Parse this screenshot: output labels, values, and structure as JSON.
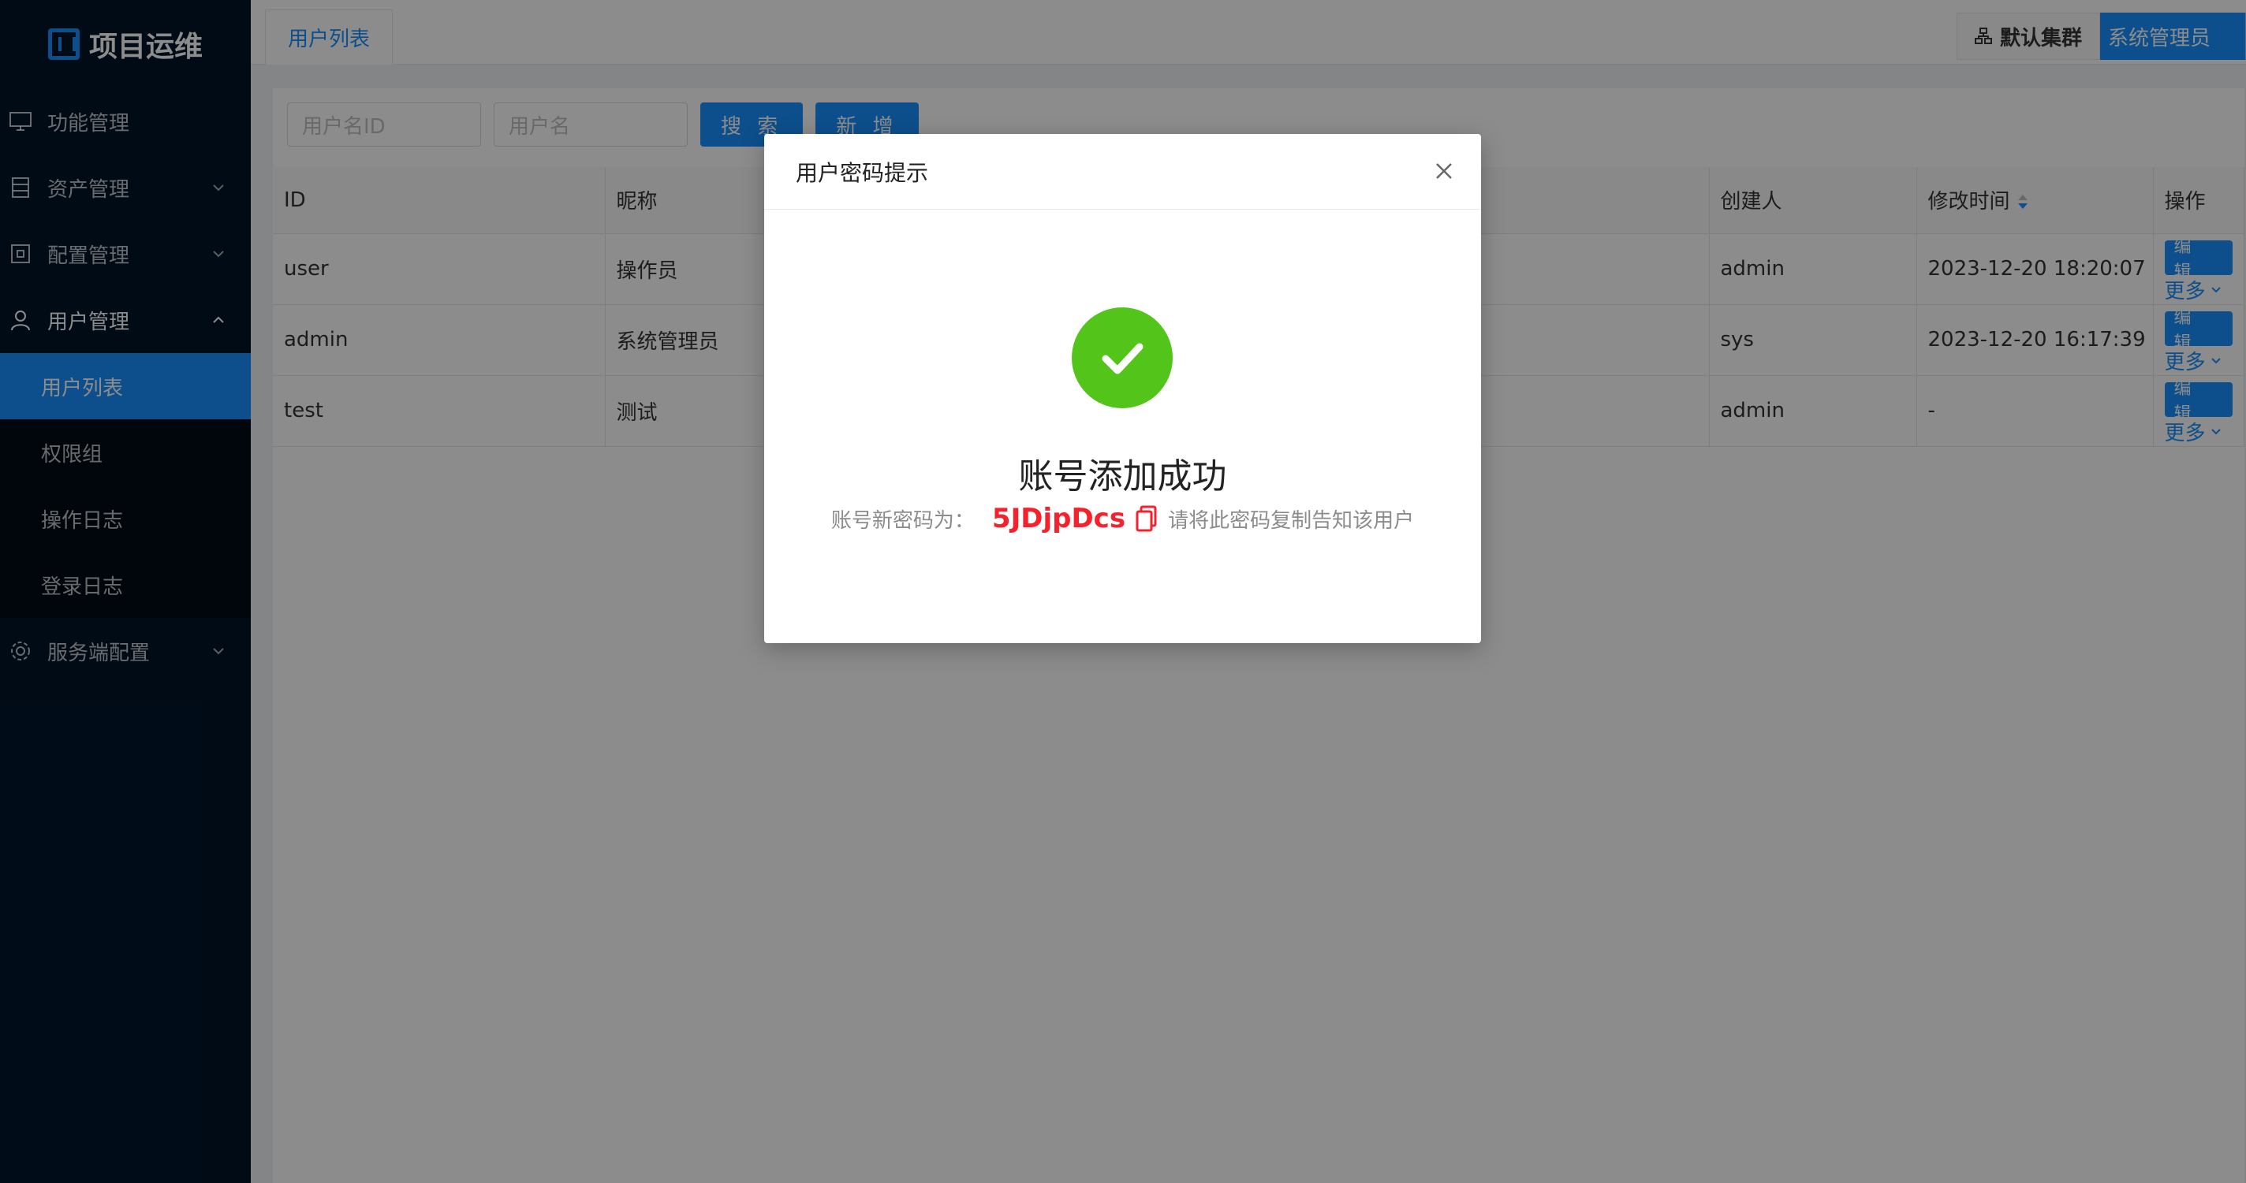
{
  "app": {
    "title": "项目运维"
  },
  "sidebar": {
    "items": [
      {
        "label": "功能管理",
        "icon": "monitor-icon"
      },
      {
        "label": "资产管理",
        "icon": "server-icon"
      },
      {
        "label": "配置管理",
        "icon": "config-icon"
      },
      {
        "label": "用户管理",
        "icon": "user-icon"
      },
      {
        "label": "服务端配置",
        "icon": "gear-icon"
      }
    ],
    "subitems": [
      {
        "label": "用户列表",
        "active": true
      },
      {
        "label": "权限组"
      },
      {
        "label": "操作日志"
      },
      {
        "label": "登录日志"
      }
    ]
  },
  "header": {
    "tab": "用户列表",
    "cluster": "默认集群",
    "user": "系统管理员"
  },
  "search": {
    "id_placeholder": "用户名ID",
    "name_placeholder": "用户名",
    "search_label": "搜 索",
    "add_label": "新 增"
  },
  "table": {
    "columns": [
      "ID",
      "昵称",
      "创建人",
      "修改时间",
      "操作"
    ],
    "rows": [
      {
        "id": "user",
        "nickname": "操作员",
        "creator": "admin",
        "modified": "2023-12-20 18:20:07"
      },
      {
        "id": "admin",
        "nickname": "系统管理员",
        "creator": "sys",
        "modified": "2023-12-20 16:17:39"
      },
      {
        "id": "test",
        "nickname": "测试",
        "creator": "admin",
        "modified": "-"
      }
    ],
    "edit_label": "编 辑",
    "more_label": "更多"
  },
  "modal": {
    "title": "用户密码提示",
    "success": "账号添加成功",
    "pwd_prefix": "账号新密码为：",
    "password": "5JDjpDcs",
    "pwd_suffix": "请将此密码复制告知该用户"
  },
  "colors": {
    "primary": "#1890ff",
    "success": "#52c41a",
    "danger": "#f5222d",
    "sider": "#001529"
  }
}
